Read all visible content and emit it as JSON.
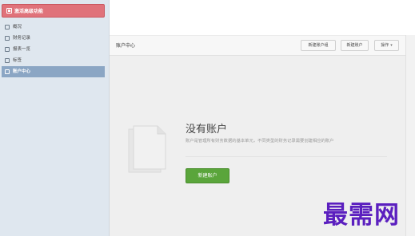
{
  "sidebar": {
    "activate": {
      "label": "激活高级功能"
    },
    "items": [
      {
        "label": "概况",
        "icon": "overview-icon"
      },
      {
        "label": "财务记录",
        "icon": "records-icon"
      },
      {
        "label": "报表一览",
        "icon": "report-icon"
      },
      {
        "label": "标签",
        "icon": "tag-icon"
      },
      {
        "label": "账户中心",
        "icon": "account-icon",
        "active": true
      }
    ]
  },
  "header": {
    "title": "账户中心",
    "buttons": {
      "new_group": "新建账户组",
      "new_account": "新建账户",
      "operation": "操作"
    }
  },
  "empty_state": {
    "title": "没有账户",
    "description": "账户是管理所有财务数据的基本单元，不同类型的财务记录需要创建相应的账户",
    "create_button": "新建账户"
  },
  "watermark": "最需网",
  "colors": {
    "activate": "#e0727a",
    "active_nav": "#8ba6c4",
    "create_button": "#5aa53b",
    "watermark": "#5b1fbf"
  }
}
